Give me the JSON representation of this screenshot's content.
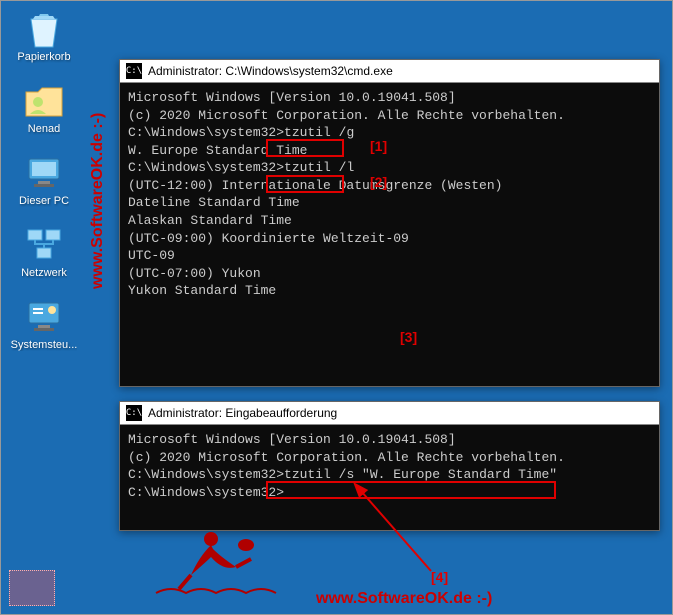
{
  "desktop": {
    "icons": [
      {
        "name": "recycle-bin",
        "label": "Papierkorb"
      },
      {
        "name": "user-folder",
        "label": "Nenad"
      },
      {
        "name": "this-pc",
        "label": "Dieser PC"
      },
      {
        "name": "network",
        "label": "Netzwerk"
      },
      {
        "name": "control-panel",
        "label": "Systemsteu..."
      }
    ]
  },
  "watermark": {
    "left": "www.SoftwareOK.de :-)",
    "bottom": "www.SoftwareOK.de :-)"
  },
  "term1": {
    "title": "Administrator: C:\\Windows\\system32\\cmd.exe",
    "lines": {
      "l0": "Microsoft Windows [Version 10.0.19041.508]",
      "l1": "(c) 2020 Microsoft Corporation. Alle Rechte vorbehalten.",
      "l2": "",
      "l3p": "C:\\Windows\\system32>",
      "l3c": "tzutil /g",
      "l4": "W. Europe Standard Time",
      "l5p": "C:\\Windows\\system32>",
      "l5c": "tzutil /l",
      "l6": "(UTC-12:00) Internationale Datumsgrenze (Westen)",
      "l7": "Dateline Standard Time",
      "l8": "",
      "l9": "Alaskan Standard Time",
      "l10": "",
      "l11": "(UTC-09:00) Koordinierte Weltzeit-09",
      "l12": "UTC-09",
      "l13": "",
      "l14": "(UTC-07:00) Yukon",
      "l15": "Yukon Standard Time"
    }
  },
  "term2": {
    "title": "Administrator: Eingabeaufforderung",
    "lines": {
      "l0": "Microsoft Windows [Version 10.0.19041.508]",
      "l1": "(c) 2020 Microsoft Corporation. Alle Rechte vorbehalten.",
      "l2": "",
      "l3p": "C:\\Windows\\system32>",
      "l3c": "tzutil /s \"W. Europe Standard Time\"",
      "l4": "",
      "l5p": "C:\\Windows\\system32>"
    }
  },
  "annotations": {
    "a1": "[1]",
    "a2": "[2]",
    "a3": "[3]",
    "a4": "[4]"
  }
}
